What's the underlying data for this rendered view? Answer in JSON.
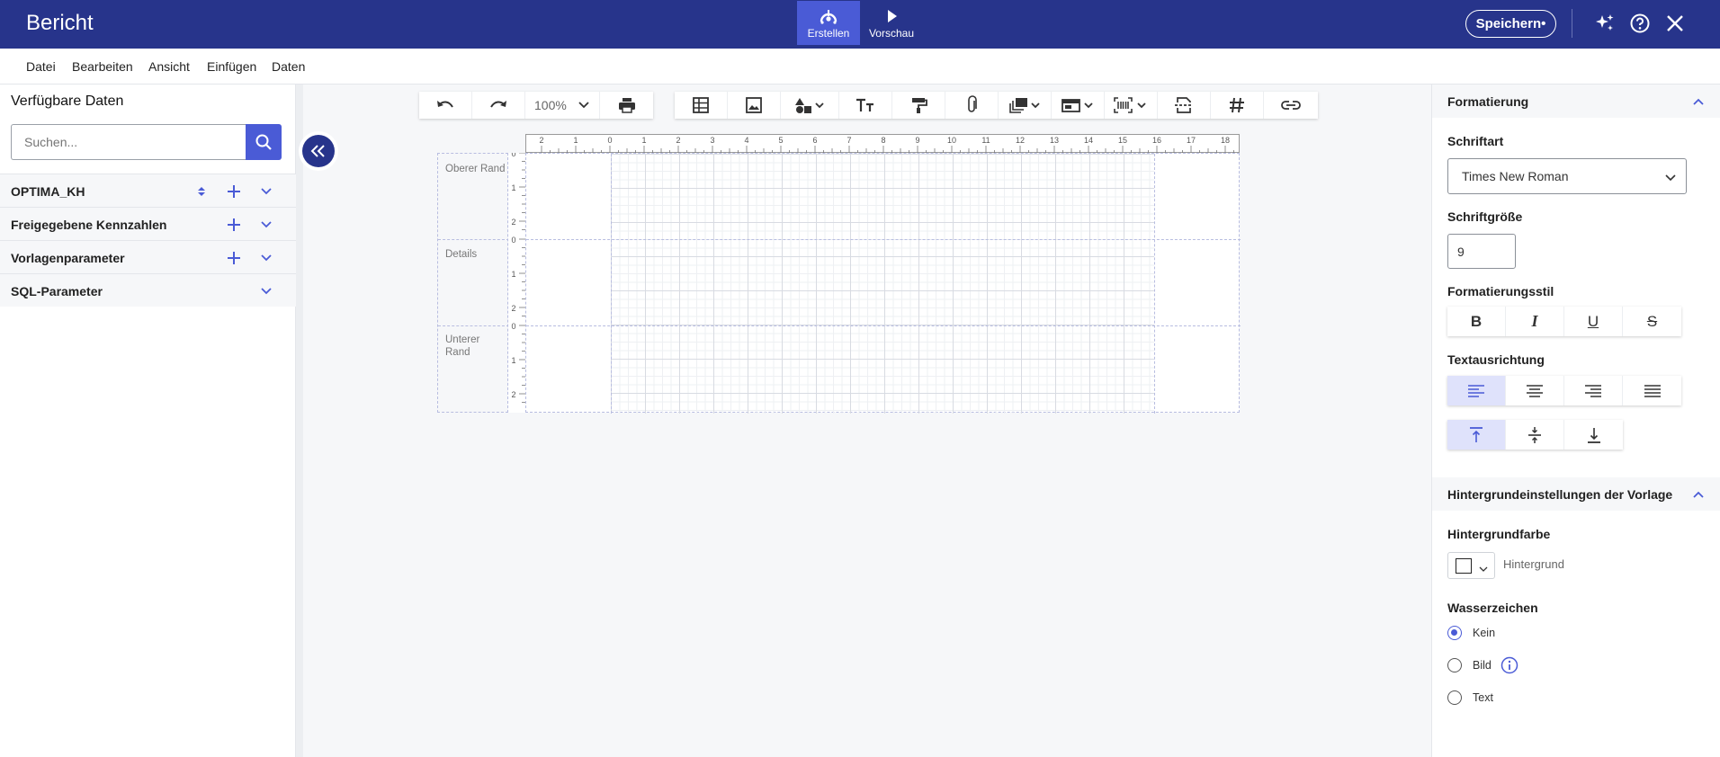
{
  "app": {
    "title": "Bericht"
  },
  "header": {
    "modes": [
      {
        "label": "Erstellen",
        "icon": "design-icon",
        "active": true
      },
      {
        "label": "Vorschau",
        "icon": "play-icon",
        "active": false
      }
    ],
    "save_label": "Speichern•",
    "icons": [
      "sparkle-icon",
      "help-icon",
      "close-icon"
    ]
  },
  "menu": {
    "items": [
      "Datei",
      "Bearbeiten",
      "Ansicht",
      "Einfügen",
      "Daten"
    ]
  },
  "sidebar": {
    "title": "Verfügbare Daten",
    "search_placeholder": "Suchen...",
    "rows": [
      {
        "label": "OPTIMA_KH",
        "sort": true,
        "add": true
      },
      {
        "label": "Freigegebene Kennzahlen",
        "sort": false,
        "add": true
      },
      {
        "label": "Vorlagenparameter",
        "sort": false,
        "add": true
      },
      {
        "label": "SQL-Parameter",
        "sort": false,
        "add": false
      }
    ]
  },
  "toolbar": {
    "zoom": "100%",
    "tools": [
      "undo-icon",
      "redo-icon",
      "zoom-select",
      "print-icon",
      "table-icon",
      "image-icon",
      "shapes-icon",
      "text-icon",
      "format-painter-icon",
      "attachment-icon",
      "layers-icon",
      "layout-icon",
      "barcode-icon",
      "page-break-icon",
      "page-number-icon",
      "link-icon"
    ]
  },
  "designer": {
    "bands": [
      {
        "label": "Oberer Rand"
      },
      {
        "label": "Details"
      },
      {
        "label": "Unterer Rand"
      }
    ],
    "hruler_labels": [
      "2",
      "1",
      "0",
      "1",
      "2",
      "3",
      "4",
      "5",
      "6",
      "7",
      "8",
      "9",
      "10",
      "11",
      "12",
      "13",
      "14",
      "15",
      "16",
      "17",
      "18"
    ],
    "vruler_labels": [
      "0",
      "1",
      "2"
    ]
  },
  "formatting": {
    "section_title": "Formatierung",
    "font_label": "Schriftart",
    "font_value": "Times New Roman",
    "size_label": "Schriftgröße",
    "size_value": "9",
    "style_label": "Formatierungsstil",
    "styles": [
      "B",
      "I",
      "U",
      "S"
    ],
    "align_label": "Textausrichtung",
    "halign": [
      "left",
      "center",
      "right",
      "justify"
    ],
    "valign": [
      "top",
      "middle",
      "bottom"
    ]
  },
  "background": {
    "section_title": "Hintergrundeinstellungen der Vorlage",
    "color_label": "Hintergrundfarbe",
    "color_text": "Hintergrund",
    "color_value": "#ffffff",
    "watermark_label": "Wasserzeichen",
    "watermark_options": [
      "Kein",
      "Bild",
      "Text"
    ],
    "watermark_selected": "Kein"
  },
  "colors": {
    "header": "#27348b",
    "accent": "#4a5bd6"
  }
}
